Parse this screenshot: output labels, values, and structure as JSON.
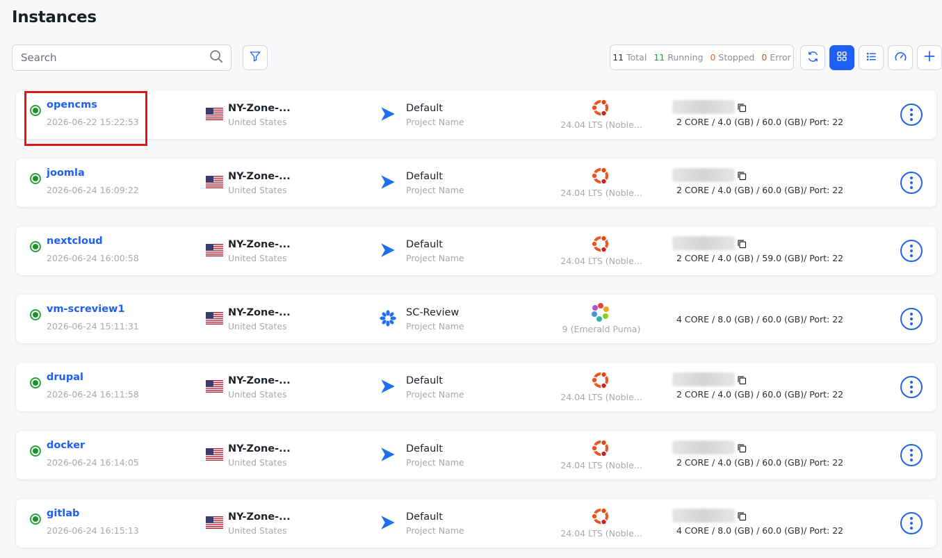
{
  "page": {
    "title": "Instances"
  },
  "search": {
    "placeholder": "Search"
  },
  "stats": {
    "total_count": "11",
    "total_label": "Total",
    "running_count": "11",
    "running_label": "Running",
    "stopped_count": "0",
    "stopped_label": "Stopped",
    "error_count": "0",
    "error_label": "Error"
  },
  "colors": {
    "accent": "#1f5ff5",
    "running": "#2a9d3a",
    "stopped": "#e4682a",
    "error": "#e74c3c",
    "highlight": "#e01414"
  },
  "toolbar": {
    "icons": [
      "filter-icon",
      "refresh-icon",
      "grid-view-icon",
      "list-view-icon",
      "speedometer-icon",
      "plus-icon"
    ]
  },
  "instances": [
    {
      "name": "opencms",
      "created": "2026-06-22 15:22:53",
      "zone": "NY-Zone-...",
      "country": "United States",
      "project": "Default",
      "project_label": "Project Name",
      "os_version": "24.04 LTS (Noble...",
      "os": "ubuntu",
      "specs": "2 CORE / 4.0 (GB) / 60.0 (GB)/ Port: 22",
      "status": "running"
    },
    {
      "name": "joomla",
      "created": "2026-06-24 16:09:22",
      "zone": "NY-Zone-...",
      "country": "United States",
      "project": "Default",
      "project_label": "Project Name",
      "os_version": "24.04 LTS (Noble...",
      "os": "ubuntu",
      "specs": "2 CORE / 4.0 (GB) / 60.0 (GB)/ Port: 22",
      "status": "running"
    },
    {
      "name": "nextcloud",
      "created": "2026-06-24 16:00:58",
      "zone": "NY-Zone-...",
      "country": "United States",
      "project": "Default",
      "project_label": "Project Name",
      "os_version": "24.04 LTS (Noble...",
      "os": "ubuntu",
      "specs": "2 CORE / 4.0 (GB) / 59.0 (GB)/ Port: 22",
      "status": "running"
    },
    {
      "name": "vm-screview1",
      "created": "2026-06-24 15:11:31",
      "zone": "NY-Zone-...",
      "country": "United States",
      "project": "SC-Review",
      "project_label": "Project Name",
      "os_version": "9 (Emerald Puma)",
      "os": "other",
      "specs": "4 CORE / 8.0 (GB) / 60.0 (GB)/ Port: 22",
      "status": "running"
    },
    {
      "name": "drupal",
      "created": "2026-06-24 16:11:58",
      "zone": "NY-Zone-...",
      "country": "United States",
      "project": "Default",
      "project_label": "Project Name",
      "os_version": "24.04 LTS (Noble...",
      "os": "ubuntu",
      "specs": "2 CORE / 4.0 (GB) / 60.0 (GB)/ Port: 22",
      "status": "running"
    },
    {
      "name": "docker",
      "created": "2026-06-24 16:14:05",
      "zone": "NY-Zone-...",
      "country": "United States",
      "project": "Default",
      "project_label": "Project Name",
      "os_version": "24.04 LTS (Noble...",
      "os": "ubuntu",
      "specs": "2 CORE / 4.0 (GB) / 60.0 (GB)/ Port: 22",
      "status": "running"
    },
    {
      "name": "gitlab",
      "created": "2026-06-24 16:15:13",
      "zone": "NY-Zone-...",
      "country": "United States",
      "project": "Default",
      "project_label": "Project Name",
      "os_version": "24.04 LTS (Noble...",
      "os": "ubuntu",
      "specs": "4 CORE / 8.0 (GB) / 60.0 (GB)/ Port: 22",
      "status": "running"
    }
  ]
}
